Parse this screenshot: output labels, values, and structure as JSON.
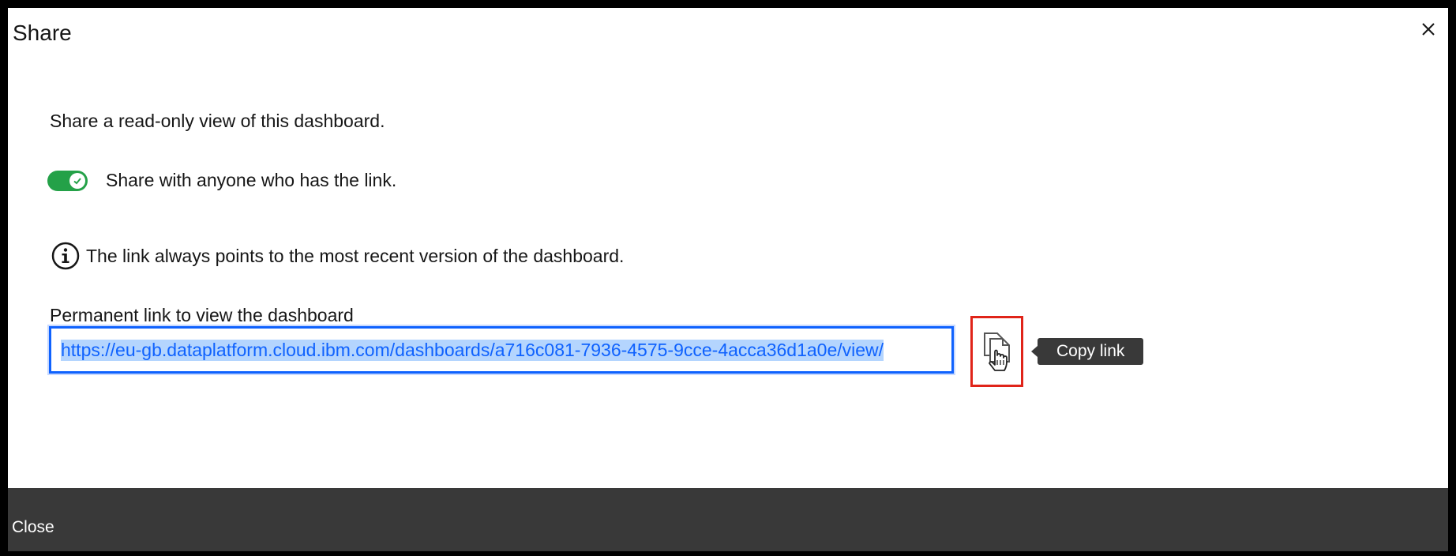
{
  "modal": {
    "title": "Share",
    "description": "Share a read-only view of this dashboard.",
    "toggle": {
      "label": "Share with anyone who has the link.",
      "state": "on",
      "color": "#24a148"
    },
    "info": {
      "icon": "info-icon",
      "text": "The link always points to the most recent version of the dashboard."
    },
    "link_field": {
      "label": "Permanent link to view the dashboard",
      "value": "https://eu-gb.dataplatform.cloud.ibm.com/dashboards/a716c081-7936-4575-9cce-4acca36d1a0e/view/"
    },
    "copy_button": {
      "icon": "copy-icon",
      "tooltip": "Copy link"
    },
    "close_icon": "close-icon",
    "footer": {
      "close_label": "Close"
    }
  },
  "colors": {
    "accent": "#0f62fe",
    "highlight_border": "#e02419",
    "footer_bg": "#393939"
  }
}
